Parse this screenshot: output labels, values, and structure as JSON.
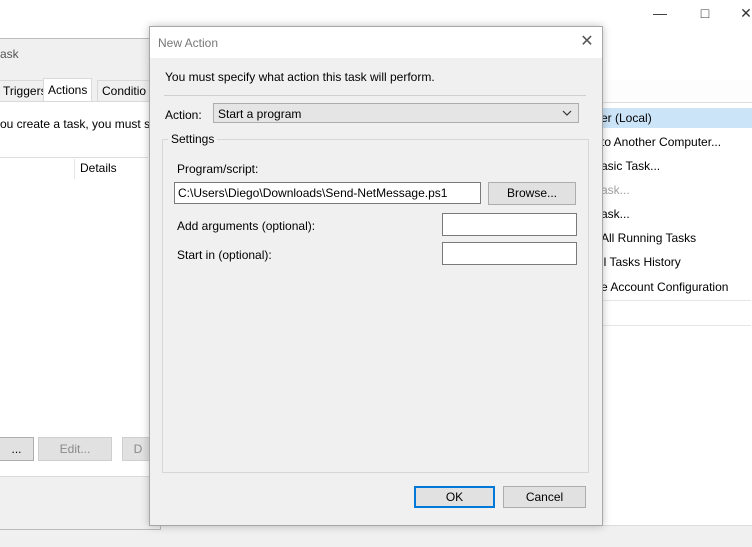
{
  "main_window": {
    "actions_pane": {
      "items": [
        {
          "label": "er (Local)",
          "disabled": false
        },
        {
          "label": "to Another Computer...",
          "disabled": false
        },
        {
          "label": "asic Task...",
          "disabled": false
        },
        {
          "label": "ask...",
          "disabled": true
        },
        {
          "label": "ask...",
          "disabled": false
        },
        {
          "label": "All Running Tasks",
          "disabled": false
        },
        {
          "label": "ll Tasks History",
          "disabled": false
        },
        {
          "label": "e Account Configuration",
          "disabled": false
        }
      ]
    }
  },
  "task_window": {
    "title": "ask",
    "tabs": [
      {
        "label": "Triggers",
        "active": false
      },
      {
        "label": "Actions",
        "active": true
      },
      {
        "label": "Conditio",
        "active": false
      }
    ],
    "intro_text": "ou create a task, you must sp",
    "column_details": "Details",
    "buttons": {
      "new_label": "...",
      "edit_label": "Edit...",
      "delete_label": "D"
    }
  },
  "new_action_dialog": {
    "title": "New Action",
    "close_glyph": "✕",
    "instruction": "You must specify what action this task will perform.",
    "action_label": "Action:",
    "action_value": "Start a program",
    "settings_label": "Settings",
    "program_label": "Program/script:",
    "program_value": "C:\\Users\\Diego\\Downloads\\Send-NetMessage.ps1",
    "browse_label": "Browse...",
    "arguments_label": "Add arguments (optional):",
    "arguments_value": "",
    "start_in_label": "Start in (optional):",
    "start_in_value": "",
    "ok_label": "OK",
    "cancel_label": "Cancel",
    "accent_color": "#0078d7"
  }
}
